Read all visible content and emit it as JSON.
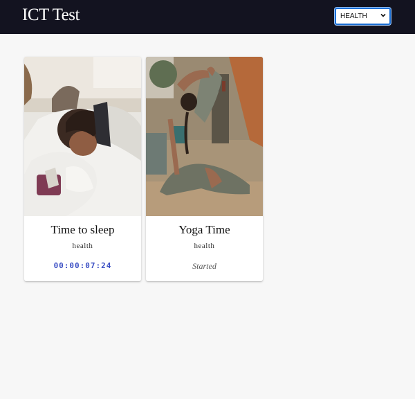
{
  "header": {
    "title": "ICT Test",
    "filter": {
      "selected": "HEALTH",
      "arrow_icon": "chevron-down-icon"
    },
    "colors": {
      "bar": "#131320",
      "select_border": "#1a6fd6"
    }
  },
  "cards": [
    {
      "title": "Time to sleep",
      "category": "health",
      "timer": "00:00:07:24",
      "image": "sleeping-person-photo"
    },
    {
      "title": "Yoga Time",
      "category": "health",
      "status": "Started",
      "image": "yoga-pose-photo"
    }
  ],
  "colors": {
    "timer": "#3b4fc4",
    "background": "#f7f7f7"
  }
}
